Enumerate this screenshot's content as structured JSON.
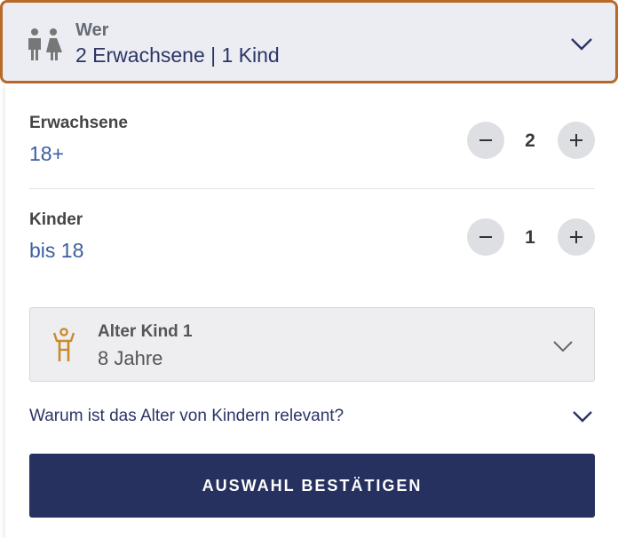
{
  "who": {
    "label": "Wer",
    "value": "2 Erwachsene | 1 Kind",
    "icon": "two-persons-icon"
  },
  "adults": {
    "title": "Erwachsene",
    "subtitle": "18+",
    "count": "2"
  },
  "children": {
    "title": "Kinder",
    "subtitle": "bis 18",
    "count": "1"
  },
  "child_age": {
    "label": "Alter Kind 1",
    "value": "8 Jahre",
    "icon": "child-icon"
  },
  "why": {
    "text": "Warum ist das Alter von Kindern relevant?"
  },
  "confirm": {
    "label": "AUSWAHL BESTÄTIGEN"
  },
  "colors": {
    "accent_border": "#b86a2a",
    "primary": "#263160",
    "link_blue": "#3c5ea0",
    "child_icon": "#c98a2e"
  }
}
